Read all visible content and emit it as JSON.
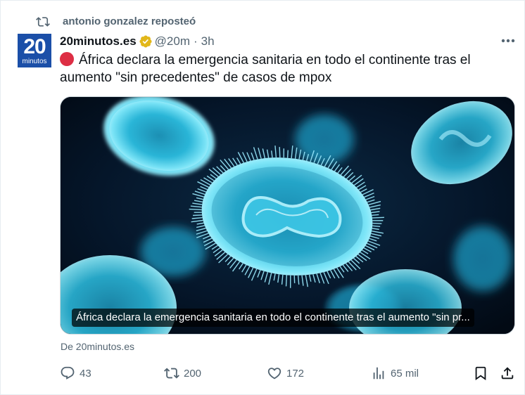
{
  "repost": {
    "text": "antonio gonzalez reposteó",
    "icon": "repost-icon"
  },
  "avatar": {
    "number": "20",
    "word": "minutos",
    "color": "#1b4fa8"
  },
  "tweet": {
    "display_name": "20minutos.es",
    "verified_icon": "verified-gold-badge-icon",
    "handle": "@20m",
    "separator": "·",
    "time": "3h",
    "text": "África declara la emergencia sanitaria en todo el continente tras el aumento \"sin precedentes\" de casos de mpox",
    "leading_icon": "red-circle-emoji"
  },
  "media": {
    "caption": "África declara la emergencia sanitaria en todo el continente tras el aumento \"sin pr...",
    "image_icon": "mpox-virus-image"
  },
  "source": {
    "text": "De 20minutos.es"
  },
  "actions": {
    "replies": {
      "icon": "reply-icon",
      "count": "43"
    },
    "reposts": {
      "icon": "repost-icon",
      "count": "200"
    },
    "likes": {
      "icon": "heart-icon",
      "count": "172"
    },
    "views": {
      "icon": "views-icon",
      "count": "65 mil"
    },
    "bookmark": {
      "icon": "bookmark-icon"
    },
    "share": {
      "icon": "share-icon"
    }
  },
  "colors": {
    "text_primary": "#0f1419",
    "text_secondary": "#536471",
    "verified_gold": "#e2b719",
    "red_circle": "#dd2e44",
    "virus_cyan": "#5fd6f0"
  }
}
